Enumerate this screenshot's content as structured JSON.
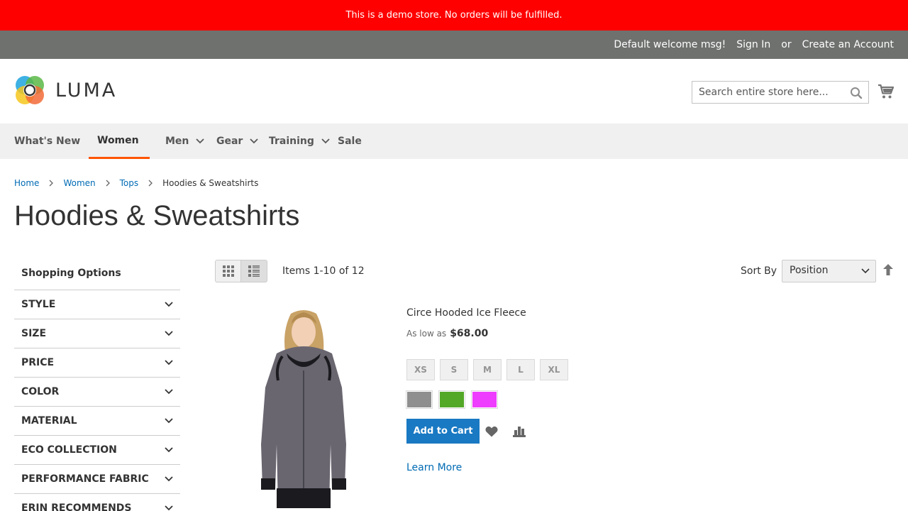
{
  "demo_notice": "This is a demo store. No orders will be fulfilled.",
  "panel": {
    "welcome": "Default welcome msg!",
    "sign_in": "Sign In",
    "or": "or",
    "create_account": "Create an Account"
  },
  "header": {
    "logo_text": "LUMA",
    "search_placeholder": "Search entire store here...",
    "search_icon": "search-icon",
    "cart_icon": "cart-icon"
  },
  "nav": {
    "items": [
      {
        "label": "What's New",
        "has_dropdown": false
      },
      {
        "label": "Women",
        "has_dropdown": true,
        "active": true
      },
      {
        "label": "Men",
        "has_dropdown": true
      },
      {
        "label": "Gear",
        "has_dropdown": true
      },
      {
        "label": "Training",
        "has_dropdown": true
      },
      {
        "label": "Sale",
        "has_dropdown": false
      }
    ]
  },
  "breadcrumbs": [
    {
      "label": "Home",
      "link": true
    },
    {
      "label": "Women",
      "link": true
    },
    {
      "label": "Tops",
      "link": true
    },
    {
      "label": "Hoodies & Sweatshirts",
      "link": false
    }
  ],
  "page_title": "Hoodies & Sweatshirts",
  "sidebar": {
    "title": "Shopping Options",
    "filters": [
      "STYLE",
      "SIZE",
      "PRICE",
      "COLOR",
      "MATERIAL",
      "ECO COLLECTION",
      "PERFORMANCE FABRIC",
      "ERIN RECOMMENDS"
    ]
  },
  "toolbar": {
    "amount": "Items 1-10 of 12",
    "sort_label": "Sort By",
    "sort_value": "Position",
    "view_modes": [
      "grid-icon",
      "list-icon"
    ],
    "active_mode": "list"
  },
  "product": {
    "name": "Circe Hooded Ice Fleece",
    "price_label": "As low as",
    "price": "$68.00",
    "sizes": [
      "XS",
      "S",
      "M",
      "L",
      "XL"
    ],
    "colors": [
      "#8f8f8f",
      "#53a828",
      "#ef3dff"
    ],
    "add_to_cart": "Add to Cart",
    "learn_more": "Learn More",
    "wishlist_icon": "heart-icon",
    "compare_icon": "compare-icon"
  },
  "colors": {
    "demo_bar": "#ff0000",
    "panel_bar": "#6e716e",
    "nav_bg": "#f0f0f0",
    "nav_active_underline": "#ff5501",
    "link": "#006bb4",
    "primary_button": "#1979c3"
  }
}
